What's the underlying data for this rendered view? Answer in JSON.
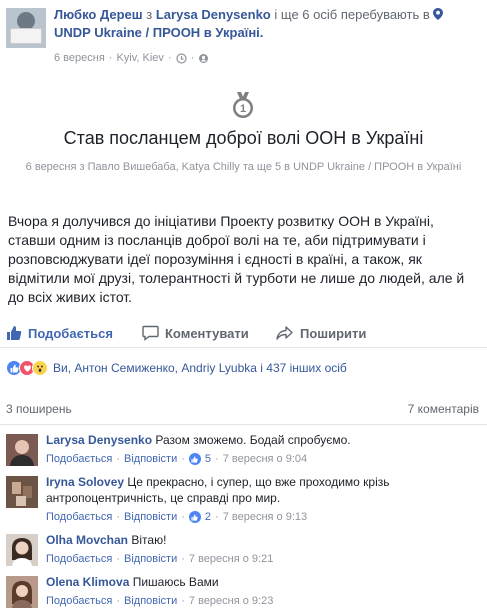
{
  "header": {
    "author": "Любко Дереш",
    "with_prefix": "з",
    "tagged": "Larysa Denysenko",
    "tagged_more": "і ще 6 осіб",
    "at_text": "перебувають в",
    "location": "UNDP Ukraine / ПРООН в Україні.",
    "date": "6 вересня",
    "place": "Kyiv, Kiev",
    "dot": "·",
    "more": "···"
  },
  "event": {
    "icon": "ribbon-award-icon",
    "title": "Став посланцем доброї волі ООН в Україні",
    "subtitle": "6 вересня з Павло Вишебаба, Katya Chilly та ще 5 в UNDP Ukraine / ПРООН в Україні"
  },
  "body": "Вчора я долучився до ініціативи Проекту розвитку ООН в Україні, ставши одним із посланців доброї волі на те, аби підтримувати і розповсюджувати ідеї порозуміння і єдності в країні, а також, як відмітили мої друзі, толерантності й турботи не лише до людей, але й до всіх живих істот.",
  "actions": {
    "like": "Подобається",
    "comment": "Коментувати",
    "share": "Поширити"
  },
  "reactions": {
    "names": "Ви, Антон Семиженко, Andriy Lyubka і 437 інших осіб"
  },
  "summary": {
    "shares": "3 поширень",
    "comments": "7 коментарів"
  },
  "colors": {
    "link": "#365899",
    "like_blue": "#4267b2",
    "meta_grey": "#90949c"
  },
  "comments": [
    {
      "name": "Larysa Denysenko",
      "text": "Разом зможемо. Бодай спробуємо.",
      "like": "Подобається",
      "reply": "Відповісти",
      "likes": "5",
      "time": "7 вересня о 9:04",
      "avatar_color": "#7a5a52"
    },
    {
      "name": "Iryna Solovey",
      "text": "Це прекрасно, і супер, що вже проходимо крізь антропоцентричність, це справді про мир.",
      "like": "Подобається",
      "reply": "Відповісти",
      "likes": "2",
      "time": "7 вересня о 9:13",
      "avatar_color": "#6b5445"
    },
    {
      "name": "Olha Movchan",
      "text": "Вітаю!",
      "like": "Подобається",
      "reply": "Відповісти",
      "likes": "",
      "time": "7 вересня о 9:21",
      "avatar_color": "#d9cfc9"
    },
    {
      "name": "Olena Klimova",
      "text": "Пишаюсь Вами",
      "like": "Подобається",
      "reply": "Відповісти",
      "likes": "",
      "time": "7 вересня о 9:23",
      "avatar_color": "#b89a8a"
    }
  ]
}
